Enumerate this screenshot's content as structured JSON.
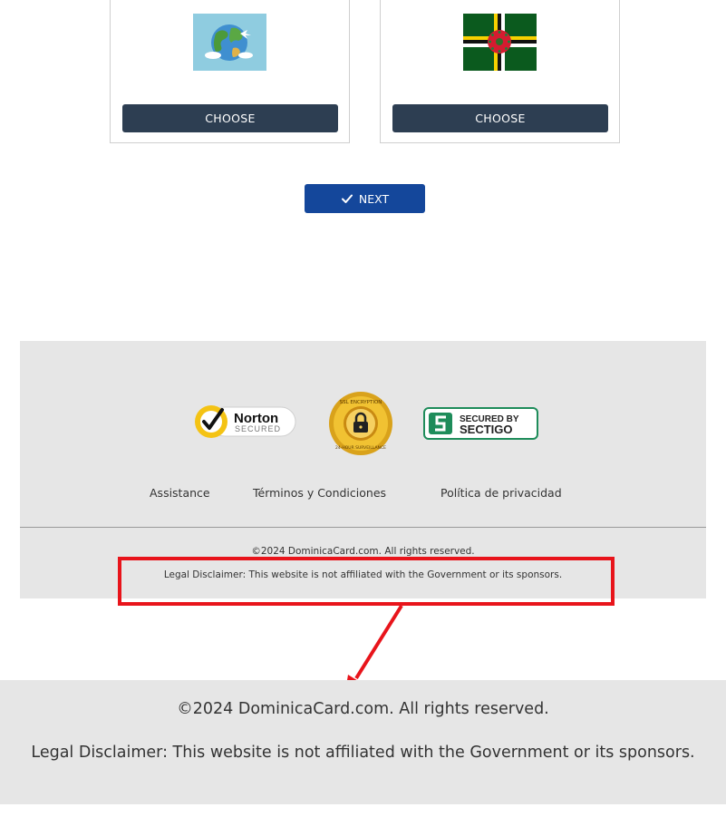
{
  "cards": [
    {
      "flag_icon": "globe-icon",
      "button_label": "CHOOSE"
    },
    {
      "flag_icon": "dominica-flag-icon",
      "button_label": "CHOOSE"
    }
  ],
  "next_button": {
    "label": "NEXT",
    "icon": "checkmark-icon"
  },
  "footer": {
    "badges": {
      "norton": {
        "brand": "Norton",
        "sub": "SECURED"
      },
      "ssl": {
        "top_text": "SSL ENCRYPTION",
        "bottom_text": "24-HOUR SURVEILLANCE"
      },
      "sectigo": {
        "line1": "SECURED BY",
        "line2": "SECTIGO"
      }
    },
    "links": [
      "Assistance",
      "Términos y Condiciones",
      "Política de privacidad"
    ],
    "copyright": "©2024 DominicaCard.com. All rights reserved.",
    "legal": "Legal Disclaimer: This website is not affiliated with the Government or its sponsors."
  },
  "zoom": {
    "copyright": "©2024 DominicaCard.com. All rights reserved.",
    "legal": "Legal Disclaimer: This website is not affiliated with the Government or its sponsors."
  },
  "colors": {
    "choose_button": "#2d3e52",
    "next_button": "#14479b",
    "footer_bg": "#e6e6e6",
    "highlight": "#e8141b"
  }
}
